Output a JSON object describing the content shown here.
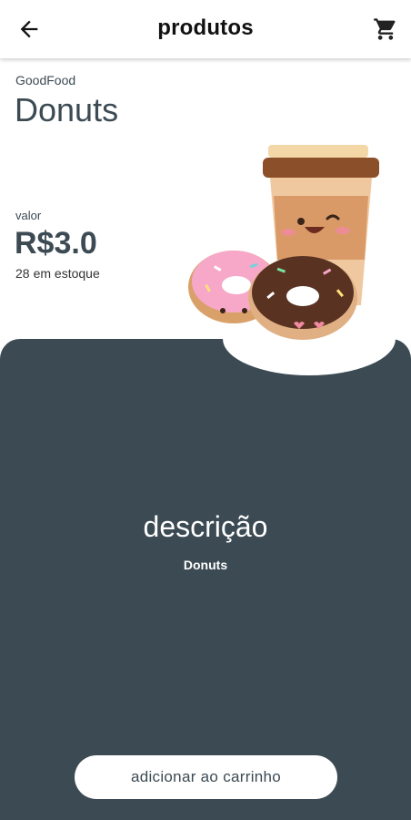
{
  "header": {
    "title": "produtos",
    "back_icon": "arrow-left-icon",
    "cart_icon": "shopping-cart-icon"
  },
  "product": {
    "brand": "GoodFood",
    "name": "Donuts",
    "price_label": "valor",
    "price": "R$3.0",
    "stock_count": "28",
    "stock_suffix": "em estoque"
  },
  "description": {
    "title": "descrição",
    "text": "Donuts"
  },
  "actions": {
    "add_to_cart": "adicionar ao carrinho"
  },
  "colors": {
    "panel": "#3c4a53",
    "button_bg": "#ffffff",
    "text_dark": "#3c4a53"
  }
}
